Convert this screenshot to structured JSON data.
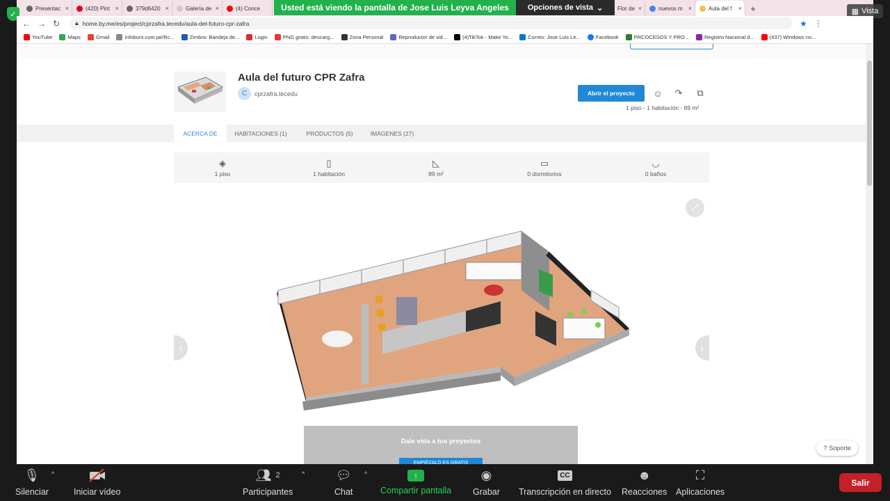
{
  "browser": {
    "tabs": [
      {
        "label": "Presentac",
        "color": "#666666"
      },
      {
        "label": "(420) Pint",
        "color": "#e60023"
      },
      {
        "label": "379d6420",
        "color": "#666666"
      },
      {
        "label": "Galería de",
        "color": "#cccccc"
      },
      {
        "label": "(4) Conce",
        "color": "#ff0000"
      },
      {
        "label": "Flor de",
        "color": "#666666"
      },
      {
        "label": "nuevos m",
        "color": "#4285f4"
      },
      {
        "label": "Aula del f",
        "color": "#f5c04a",
        "active": true
      }
    ],
    "new_tab_glyph": "+",
    "url": "home.by.me/es/project/cprzafra.tecedu/aula-del-futuro-cpr-zafra",
    "bookmarks": [
      {
        "label": "YouTube",
        "color": "#ff0000"
      },
      {
        "label": "Maps",
        "color": "#34a853"
      },
      {
        "label": "Gmail",
        "color": "#ea4335"
      },
      {
        "label": "infoburo.com.pe/Rc...",
        "color": "#888888"
      },
      {
        "label": "Zimbra: Bandeja de...",
        "color": "#1b5fa8"
      },
      {
        "label": "Login",
        "color": "#d32f2f"
      },
      {
        "label": "PNG gratis: descarg...",
        "color": "#e53935"
      },
      {
        "label": "Zona Personal",
        "color": "#333333"
      },
      {
        "label": "Reproductor de vid...",
        "color": "#5c6bc0"
      },
      {
        "label": "(4)TikTok - Make Yo...",
        "color": "#000000"
      },
      {
        "label": "Correo: Jose Luis Le...",
        "color": "#0078d4"
      },
      {
        "label": "Facebook",
        "color": "#1877f2"
      },
      {
        "label": "PRCOCESOS Y PRO...",
        "color": "#2e7d32"
      },
      {
        "label": "Registro Nacional d...",
        "color": "#8e24aa"
      },
      {
        "label": "(437) Windows no...",
        "color": "#ff0000"
      }
    ]
  },
  "zoom_top": {
    "banner": "Usted está viendo la pantalla de Jose Luis Leyva Angeles",
    "view_options": "Opciones de vista",
    "vista": "Vista"
  },
  "project": {
    "title": "Aula del futuro CPR Zafra",
    "owner_initial": "C",
    "owner": "cprzafra.tecedu",
    "open_button": "Abrir el proyecto",
    "summary": "1 piso - 1 habitación - 89 m²",
    "tabs": [
      "ACERCA DE",
      "HABITACIONES (1)",
      "PRODUCTOS (5)",
      "IMÁGENES (27)"
    ],
    "stats": [
      {
        "icon": "layers-icon",
        "label": "1 piso"
      },
      {
        "icon": "door-icon",
        "label": "1 habitación"
      },
      {
        "icon": "area-icon",
        "label": "89 m²"
      },
      {
        "icon": "bed-icon",
        "label": "0 dormitorios"
      },
      {
        "icon": "bath-icon",
        "label": "0 baños"
      }
    ],
    "promo_text": "Dale vida a tus proyectos",
    "promo_button": "EMPIÉZALO ES GRATIS",
    "support": "Soporte"
  },
  "zoom_bar": {
    "mute": "Silenciar",
    "video": "Iniciar vídeo",
    "participants": "Participantes",
    "participants_count": "2",
    "chat": "Chat",
    "share": "Compartir pantalla",
    "record": "Grabar",
    "transcription": "Transcripción en directo",
    "cc": "CC",
    "reactions": "Reacciones",
    "apps": "Aplicaciones",
    "exit": "Salir"
  },
  "colors": {
    "zoom_green": "#22b14c",
    "accent_blue": "#2088d6",
    "exit_red": "#c4202a"
  }
}
